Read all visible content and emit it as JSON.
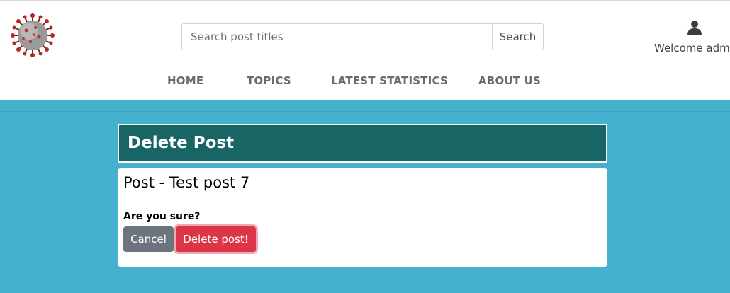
{
  "header": {
    "logo": "coronavirus-logo",
    "search": {
      "placeholder": "Search post titles",
      "value": "",
      "button_label": "Search"
    },
    "user": {
      "icon": "user-icon",
      "welcome_text": "Welcome admin"
    }
  },
  "nav": {
    "items": [
      {
        "label": "HOME"
      },
      {
        "label": "TOPICS"
      },
      {
        "label": "LATEST STATISTICS"
      },
      {
        "label": "ABOUT US"
      }
    ]
  },
  "page": {
    "heading": "Delete Post",
    "post_title": "Post - Test post 7",
    "confirm_text": "Are you sure?",
    "cancel_label": "Cancel",
    "delete_label": "Delete post!"
  },
  "colors": {
    "background": "#45b1cf",
    "header_bar": "#196566",
    "cancel_button": "#6c757d",
    "delete_button": "#dc3545"
  }
}
